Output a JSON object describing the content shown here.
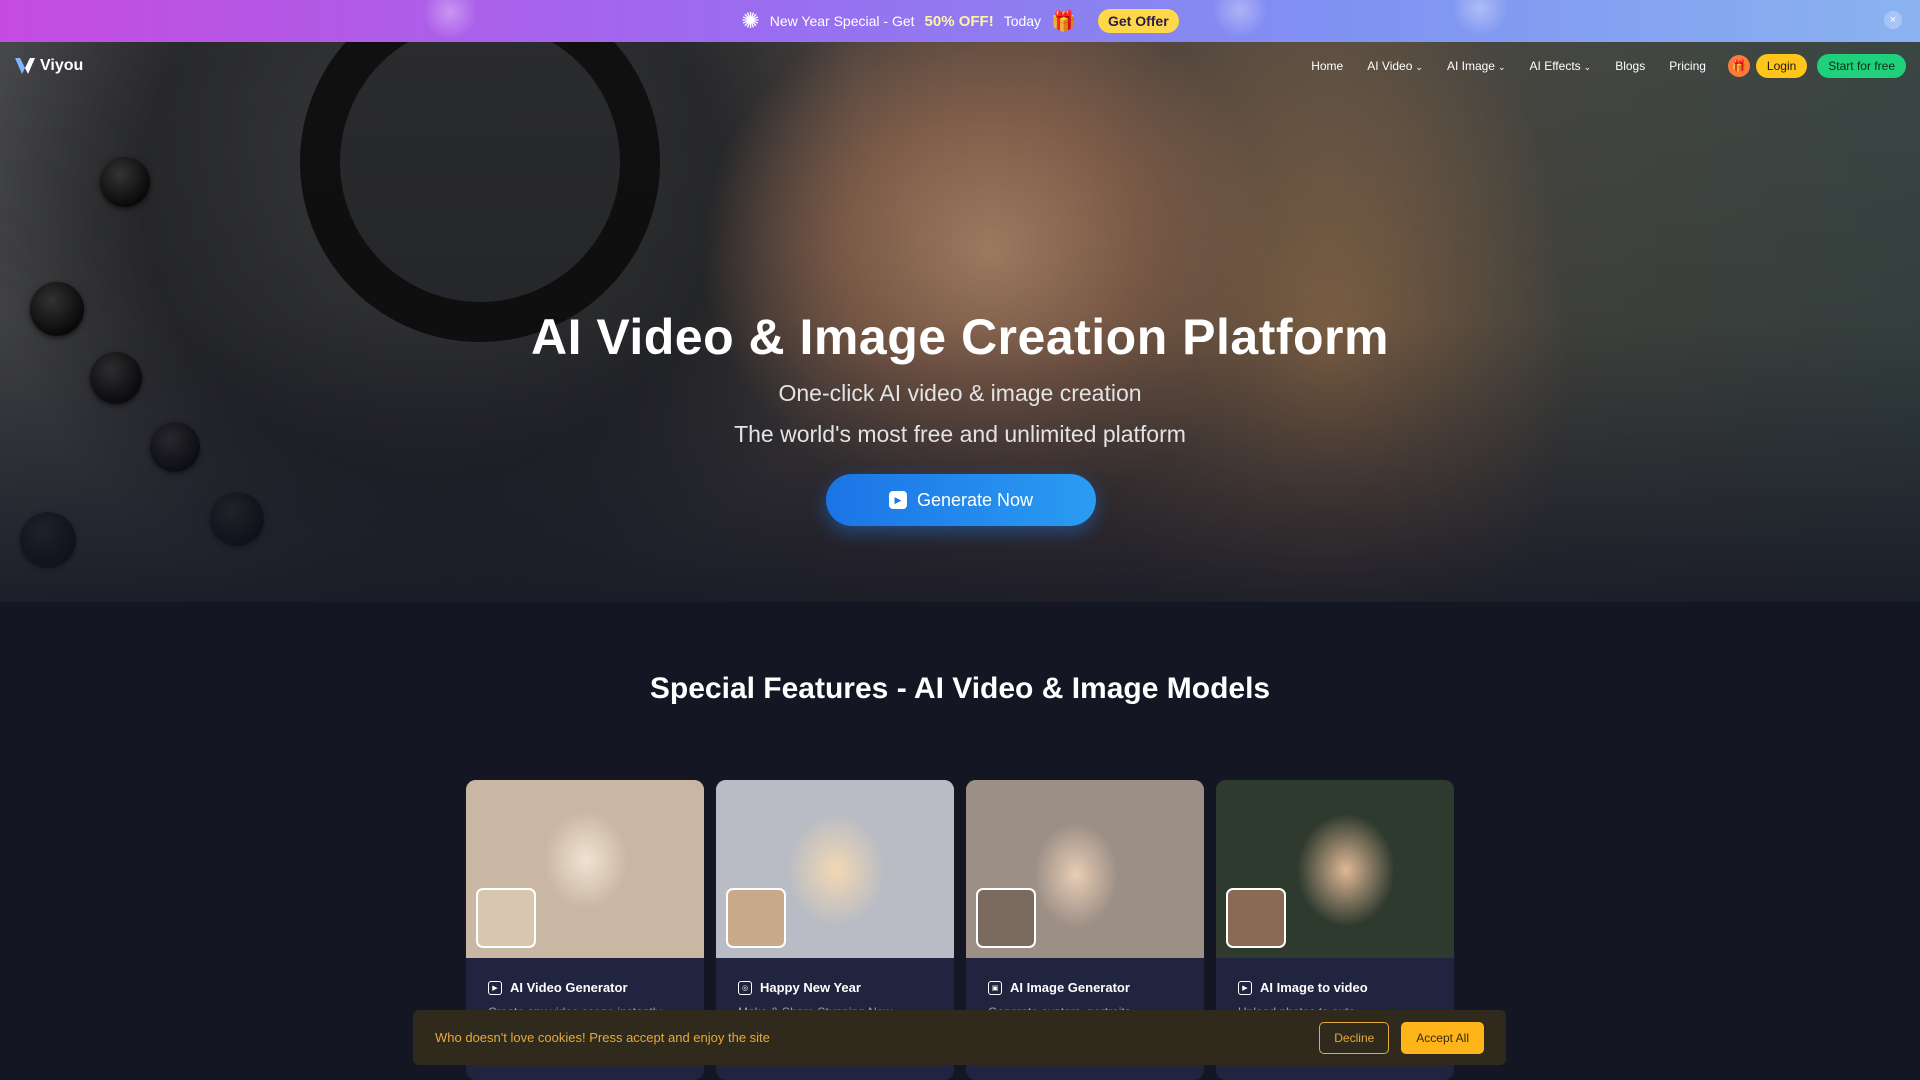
{
  "promo": {
    "text_before": "New Year Special - Get",
    "discount": "50% OFF!",
    "text_after": "Today",
    "cta": "Get Offer",
    "close": "×"
  },
  "nav": {
    "logo": "Viyou",
    "items": [
      {
        "label": "Home",
        "has_dropdown": false
      },
      {
        "label": "AI Video",
        "has_dropdown": true
      },
      {
        "label": "AI Image",
        "has_dropdown": true
      },
      {
        "label": "AI Effects",
        "has_dropdown": true
      },
      {
        "label": "Blogs",
        "has_dropdown": false
      },
      {
        "label": "Pricing",
        "has_dropdown": false
      }
    ],
    "chevron": "⌄",
    "login": "Login",
    "start": "Start for free"
  },
  "hero": {
    "title": "AI Video & Image Creation Platform",
    "subtitle": "One-click AI video & image creation",
    "subtitle2": "The world's most free and unlimited platform",
    "cta": "Generate Now"
  },
  "features": {
    "title": "Special Features - AI Video & Image Models",
    "cards": [
      {
        "title": "AI Video Generator",
        "desc": "Create any video scene instantly",
        "bg": "#c9b7a3"
      },
      {
        "title": "Happy New Year",
        "desc": "Make & Share Stunning New",
        "bg": "#b9bcc4"
      },
      {
        "title": "AI Image Generator",
        "desc": "Generate avatars, portraits",
        "bg": "#9c8f86"
      },
      {
        "title": "AI Image to video",
        "desc": "Upload photos to auto",
        "bg": "#2e3a2e"
      }
    ]
  },
  "cookie": {
    "text": "Who doesn't love cookies! Press accept and enjoy the site",
    "decline": "Decline",
    "accept": "Accept All"
  },
  "colors": {
    "accent_blue": "#1c74e6",
    "login_yellow": "#ffc51a",
    "start_green": "#1fd17a",
    "page_bg": "#141624"
  }
}
